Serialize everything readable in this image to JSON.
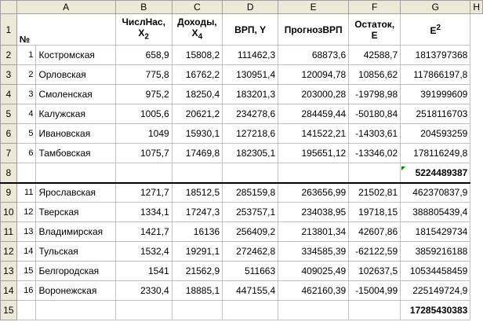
{
  "columns": [
    "A",
    "B",
    "C",
    "D",
    "E",
    "F",
    "G",
    "H"
  ],
  "header": {
    "row": "1",
    "a": "№",
    "c_line1": "ЧислНас,",
    "c_line2": "X",
    "c_sub": "2",
    "d_line1": "Доходы,",
    "d_line2": "X",
    "d_sub": "4",
    "e": "ВРП, Y",
    "f": "ПрогнозВРП",
    "g_line1": "Остаток,",
    "g_line2": "E",
    "h_base": "E",
    "h_sup": "2"
  },
  "rows": [
    {
      "row": "2",
      "n": "1",
      "name": "Костромская",
      "c": "658,9",
      "d": "15808,2",
      "e": "111462,3",
      "f": "68873,6",
      "g": "42588,7",
      "h": "1813797368"
    },
    {
      "row": "3",
      "n": "2",
      "name": "Орловская",
      "c": "775,8",
      "d": "16762,2",
      "e": "130951,4",
      "f": "120094,78",
      "g": "10856,62",
      "h": "117866197,8"
    },
    {
      "row": "4",
      "n": "3",
      "name": "Смоленская",
      "c": "975,2",
      "d": "18250,4",
      "e": "183201,3",
      "f": "203000,28",
      "g": "-19798,98",
      "h": "391999609"
    },
    {
      "row": "5",
      "n": "4",
      "name": "Калужская",
      "c": "1005,6",
      "d": "20621,2",
      "e": "234278,6",
      "f": "284459,44",
      "g": "-50180,84",
      "h": "2518116703"
    },
    {
      "row": "6",
      "n": "5",
      "name": "Ивановская",
      "c": "1049",
      "d": "15930,1",
      "e": "127218,6",
      "f": "141522,21",
      "g": "-14303,61",
      "h": "204593259"
    },
    {
      "row": "7",
      "n": "6",
      "name": "Тамбовская",
      "c": "1075,7",
      "d": "17469,8",
      "e": "182305,1",
      "f": "195651,12",
      "g": "-13346,02",
      "h": "178116249,8"
    },
    {
      "row": "8",
      "n": "",
      "name": "",
      "c": "",
      "d": "",
      "e": "",
      "f": "",
      "g": "",
      "h": "5224489387",
      "bold": true
    },
    {
      "row": "9",
      "n": "11",
      "name": "Ярославская",
      "c": "1271,7",
      "d": "18512,5",
      "e": "285159,8",
      "f": "263656,99",
      "g": "21502,81",
      "h": "462370837,9"
    },
    {
      "row": "10",
      "n": "12",
      "name": "Тверская",
      "c": "1334,1",
      "d": "17247,3",
      "e": "253757,1",
      "f": "234038,95",
      "g": "19718,15",
      "h": "388805439,4"
    },
    {
      "row": "11",
      "n": "13",
      "name": "Владимирская",
      "c": "1421,7",
      "d": "16136",
      "e": "256409,2",
      "f": "213801,34",
      "g": "42607,86",
      "h": "1815429734"
    },
    {
      "row": "12",
      "n": "14",
      "name": "Тульская",
      "c": "1532,4",
      "d": "19291,1",
      "e": "272462,8",
      "f": "334585,39",
      "g": "-62122,59",
      "h": "3859216188"
    },
    {
      "row": "13",
      "n": "15",
      "name": "Белгородская",
      "c": "1541",
      "d": "21562,9",
      "e": "511663",
      "f": "409025,49",
      "g": "102637,5",
      "h": "10534458459"
    },
    {
      "row": "14",
      "n": "16",
      "name": "Воронежская",
      "c": "2330,4",
      "d": "18885,1",
      "e": "447155,4",
      "f": "462160,39",
      "g": "-15004,99",
      "h": "225149724,9"
    },
    {
      "row": "15",
      "n": "",
      "name": "",
      "c": "",
      "d": "",
      "e": "",
      "f": "",
      "g": "",
      "h": "17285430383",
      "bold": true
    }
  ]
}
